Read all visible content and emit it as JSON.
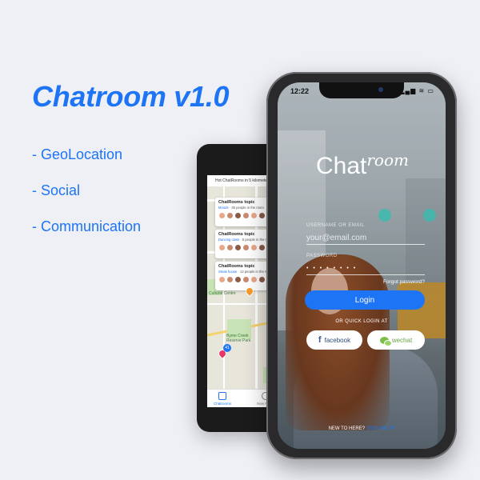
{
  "promo": {
    "title": "Chatroom v1.0",
    "features": [
      "- GeoLocation",
      "- Social",
      "- Communication"
    ]
  },
  "back_phone": {
    "header_text": "Hot ChatRooms in 5 kilometers",
    "topics": [
      {
        "title": "ChatRooms topic",
        "link": "Moods",
        "sub": " · 35 people in the room"
      },
      {
        "title": "ChatRooms topic",
        "link": "Dancing class",
        "sub": " · 6 people in the room"
      },
      {
        "title": "ChatRooms topic",
        "link": "Steak house",
        "sub": " · 12 people in the room"
      }
    ],
    "map_labels": {
      "cultural": "Cultural Centre",
      "park": "Byme Creek Reserve Park"
    },
    "badge": "41",
    "tabs": [
      "Chatrooms",
      "New Room"
    ],
    "colors": {
      "accent": "#1d74f5"
    }
  },
  "login": {
    "status_time": "12:22",
    "status_icons": "▂▄▆ ≋ ▭",
    "logo_main": "Chat",
    "logo_room": "room",
    "username_label": "USERNAME OR EMAIL",
    "username_placeholder": "your@email.com",
    "password_label": "PASSWORD",
    "password_value": "• • • • • • • •",
    "forgot": "Forgot password?",
    "login_button": "Login",
    "or_quick": "OR QUICK LOGIN AT",
    "facebook": "facebook",
    "wechat": "wechat",
    "new_here": "NEW TO HERE?",
    "signup": "SIGN ME UP"
  }
}
